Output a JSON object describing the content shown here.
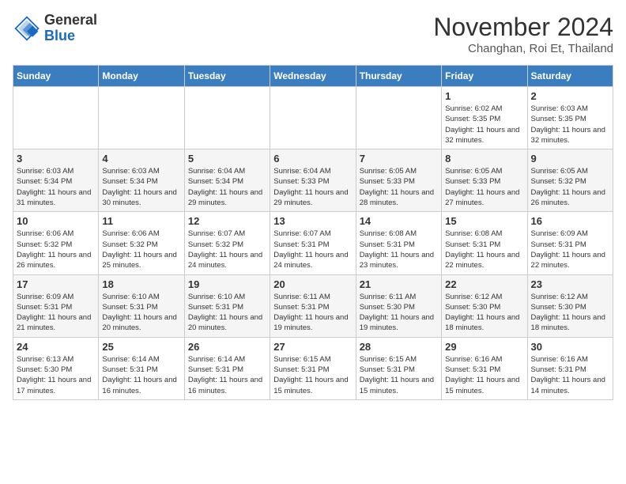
{
  "header": {
    "logo_line1": "General",
    "logo_line2": "Blue",
    "month": "November 2024",
    "location": "Changhan, Roi Et, Thailand"
  },
  "weekdays": [
    "Sunday",
    "Monday",
    "Tuesday",
    "Wednesday",
    "Thursday",
    "Friday",
    "Saturday"
  ],
  "weeks": [
    [
      {
        "day": "",
        "info": ""
      },
      {
        "day": "",
        "info": ""
      },
      {
        "day": "",
        "info": ""
      },
      {
        "day": "",
        "info": ""
      },
      {
        "day": "",
        "info": ""
      },
      {
        "day": "1",
        "info": "Sunrise: 6:02 AM\nSunset: 5:35 PM\nDaylight: 11 hours and 32 minutes."
      },
      {
        "day": "2",
        "info": "Sunrise: 6:03 AM\nSunset: 5:35 PM\nDaylight: 11 hours and 32 minutes."
      }
    ],
    [
      {
        "day": "3",
        "info": "Sunrise: 6:03 AM\nSunset: 5:34 PM\nDaylight: 11 hours and 31 minutes."
      },
      {
        "day": "4",
        "info": "Sunrise: 6:03 AM\nSunset: 5:34 PM\nDaylight: 11 hours and 30 minutes."
      },
      {
        "day": "5",
        "info": "Sunrise: 6:04 AM\nSunset: 5:34 PM\nDaylight: 11 hours and 29 minutes."
      },
      {
        "day": "6",
        "info": "Sunrise: 6:04 AM\nSunset: 5:33 PM\nDaylight: 11 hours and 29 minutes."
      },
      {
        "day": "7",
        "info": "Sunrise: 6:05 AM\nSunset: 5:33 PM\nDaylight: 11 hours and 28 minutes."
      },
      {
        "day": "8",
        "info": "Sunrise: 6:05 AM\nSunset: 5:33 PM\nDaylight: 11 hours and 27 minutes."
      },
      {
        "day": "9",
        "info": "Sunrise: 6:05 AM\nSunset: 5:32 PM\nDaylight: 11 hours and 26 minutes."
      }
    ],
    [
      {
        "day": "10",
        "info": "Sunrise: 6:06 AM\nSunset: 5:32 PM\nDaylight: 11 hours and 26 minutes."
      },
      {
        "day": "11",
        "info": "Sunrise: 6:06 AM\nSunset: 5:32 PM\nDaylight: 11 hours and 25 minutes."
      },
      {
        "day": "12",
        "info": "Sunrise: 6:07 AM\nSunset: 5:32 PM\nDaylight: 11 hours and 24 minutes."
      },
      {
        "day": "13",
        "info": "Sunrise: 6:07 AM\nSunset: 5:31 PM\nDaylight: 11 hours and 24 minutes."
      },
      {
        "day": "14",
        "info": "Sunrise: 6:08 AM\nSunset: 5:31 PM\nDaylight: 11 hours and 23 minutes."
      },
      {
        "day": "15",
        "info": "Sunrise: 6:08 AM\nSunset: 5:31 PM\nDaylight: 11 hours and 22 minutes."
      },
      {
        "day": "16",
        "info": "Sunrise: 6:09 AM\nSunset: 5:31 PM\nDaylight: 11 hours and 22 minutes."
      }
    ],
    [
      {
        "day": "17",
        "info": "Sunrise: 6:09 AM\nSunset: 5:31 PM\nDaylight: 11 hours and 21 minutes."
      },
      {
        "day": "18",
        "info": "Sunrise: 6:10 AM\nSunset: 5:31 PM\nDaylight: 11 hours and 20 minutes."
      },
      {
        "day": "19",
        "info": "Sunrise: 6:10 AM\nSunset: 5:31 PM\nDaylight: 11 hours and 20 minutes."
      },
      {
        "day": "20",
        "info": "Sunrise: 6:11 AM\nSunset: 5:31 PM\nDaylight: 11 hours and 19 minutes."
      },
      {
        "day": "21",
        "info": "Sunrise: 6:11 AM\nSunset: 5:30 PM\nDaylight: 11 hours and 19 minutes."
      },
      {
        "day": "22",
        "info": "Sunrise: 6:12 AM\nSunset: 5:30 PM\nDaylight: 11 hours and 18 minutes."
      },
      {
        "day": "23",
        "info": "Sunrise: 6:12 AM\nSunset: 5:30 PM\nDaylight: 11 hours and 18 minutes."
      }
    ],
    [
      {
        "day": "24",
        "info": "Sunrise: 6:13 AM\nSunset: 5:30 PM\nDaylight: 11 hours and 17 minutes."
      },
      {
        "day": "25",
        "info": "Sunrise: 6:14 AM\nSunset: 5:31 PM\nDaylight: 11 hours and 16 minutes."
      },
      {
        "day": "26",
        "info": "Sunrise: 6:14 AM\nSunset: 5:31 PM\nDaylight: 11 hours and 16 minutes."
      },
      {
        "day": "27",
        "info": "Sunrise: 6:15 AM\nSunset: 5:31 PM\nDaylight: 11 hours and 15 minutes."
      },
      {
        "day": "28",
        "info": "Sunrise: 6:15 AM\nSunset: 5:31 PM\nDaylight: 11 hours and 15 minutes."
      },
      {
        "day": "29",
        "info": "Sunrise: 6:16 AM\nSunset: 5:31 PM\nDaylight: 11 hours and 15 minutes."
      },
      {
        "day": "30",
        "info": "Sunrise: 6:16 AM\nSunset: 5:31 PM\nDaylight: 11 hours and 14 minutes."
      }
    ]
  ]
}
